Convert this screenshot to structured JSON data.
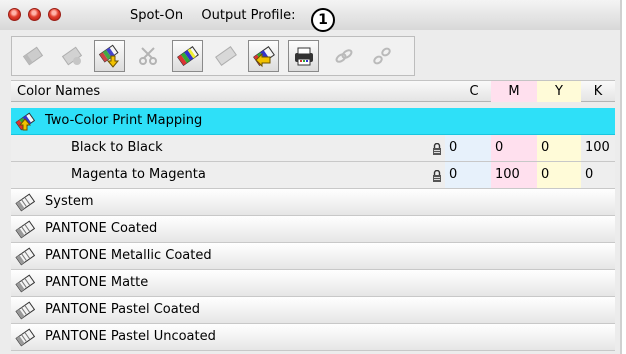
{
  "window": {
    "title": "Spot-On",
    "subtitle": "Output Profile:",
    "callout": "1",
    "traffic_lights": {
      "color": "#e2402f"
    }
  },
  "toolbar": {
    "buttons": [
      {
        "icon": "color-book-icon",
        "state": "disabled"
      },
      {
        "icon": "new-group-icon",
        "state": "disabled"
      },
      {
        "icon": "import-colors-icon",
        "state": "enabled"
      },
      {
        "icon": "cut-icon",
        "state": "disabled"
      },
      {
        "icon": "color-book-icon",
        "state": "enabled"
      },
      {
        "icon": "color-book-icon",
        "state": "disabled"
      },
      {
        "icon": "export-colors-icon",
        "state": "enabled"
      },
      {
        "icon": "print-swatch-icon",
        "state": "enabled"
      },
      {
        "icon": "link-icon",
        "state": "disabled"
      },
      {
        "icon": "unlink-icon",
        "state": "disabled"
      }
    ]
  },
  "table": {
    "headers": {
      "name": "Color Names",
      "c": "C",
      "m": "M",
      "y": "Y",
      "k": "K"
    },
    "rows": [
      {
        "label": "Two-Color Print Mapping",
        "icon": "two-color-mapping-icon"
      },
      {
        "label": "Black to Black",
        "c": "0",
        "m": "0",
        "y": "0",
        "k": "100",
        "icon": "lock-icon"
      },
      {
        "label": "Magenta to Magenta",
        "c": "0",
        "m": "100",
        "y": "0",
        "k": "0",
        "icon": "lock-icon"
      },
      {
        "label": "System",
        "icon": "color-book-icon"
      },
      {
        "label": "PANTONE Coated",
        "icon": "color-book-icon"
      },
      {
        "label": "PANTONE Metallic Coated",
        "icon": "color-book-icon"
      },
      {
        "label": "PANTONE Matte",
        "icon": "color-book-icon"
      },
      {
        "label": "PANTONE Pastel Coated",
        "icon": "color-book-icon"
      },
      {
        "label": "PANTONE Pastel Uncoated",
        "icon": "color-book-icon"
      }
    ],
    "selected_color": "#2ee0f8"
  }
}
